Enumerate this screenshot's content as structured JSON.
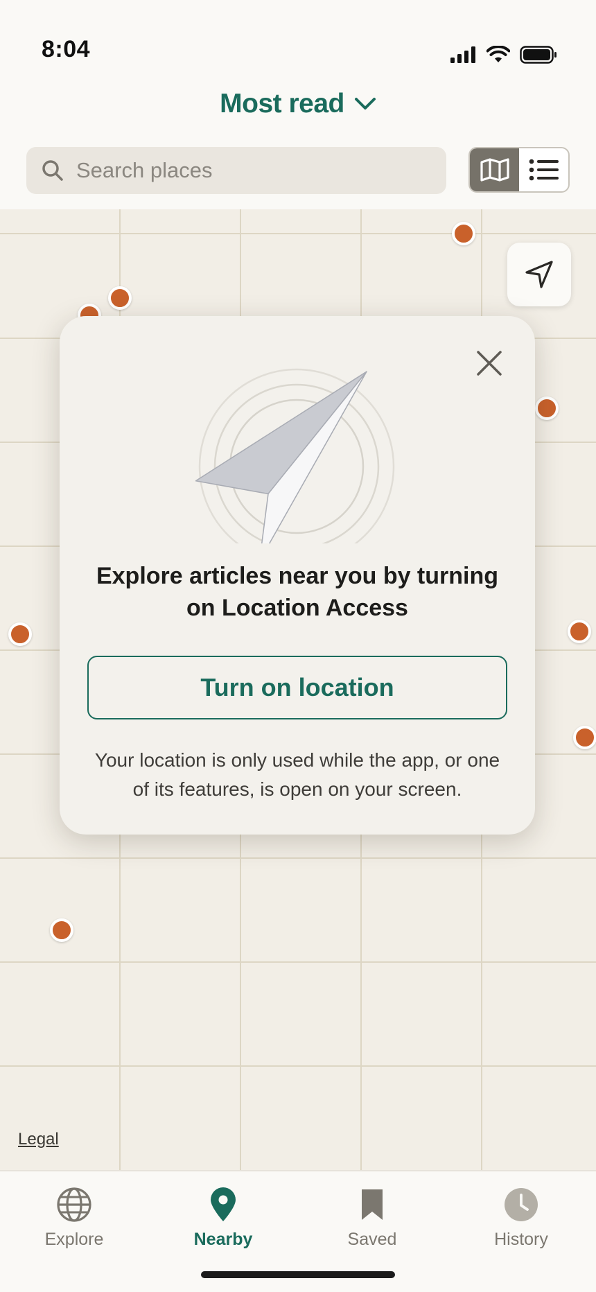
{
  "status_bar": {
    "time": "8:04"
  },
  "header": {
    "title": "Most read"
  },
  "search": {
    "placeholder": "Search places"
  },
  "view_toggle": {
    "selected": "map",
    "options": [
      "map",
      "list"
    ]
  },
  "map": {
    "legal_link": "Legal"
  },
  "modal": {
    "heading": "Explore articles near you by turning on Location Access",
    "cta_label": "Turn on location",
    "disclaimer": "Your location is only used while the app, or one of its features, is open on your screen."
  },
  "bottom_nav": {
    "items": [
      {
        "label": "Explore",
        "icon": "globe-icon",
        "active": false
      },
      {
        "label": "Nearby",
        "icon": "location-pin-icon",
        "active": true
      },
      {
        "label": "Saved",
        "icon": "bookmark-icon",
        "active": false
      },
      {
        "label": "History",
        "icon": "clock-icon",
        "active": false
      }
    ]
  },
  "colors": {
    "accent": "#1a6b5c",
    "pin": "#c9612b",
    "map_background": "#f2eee6",
    "grid_line": "#ddd6c4"
  }
}
